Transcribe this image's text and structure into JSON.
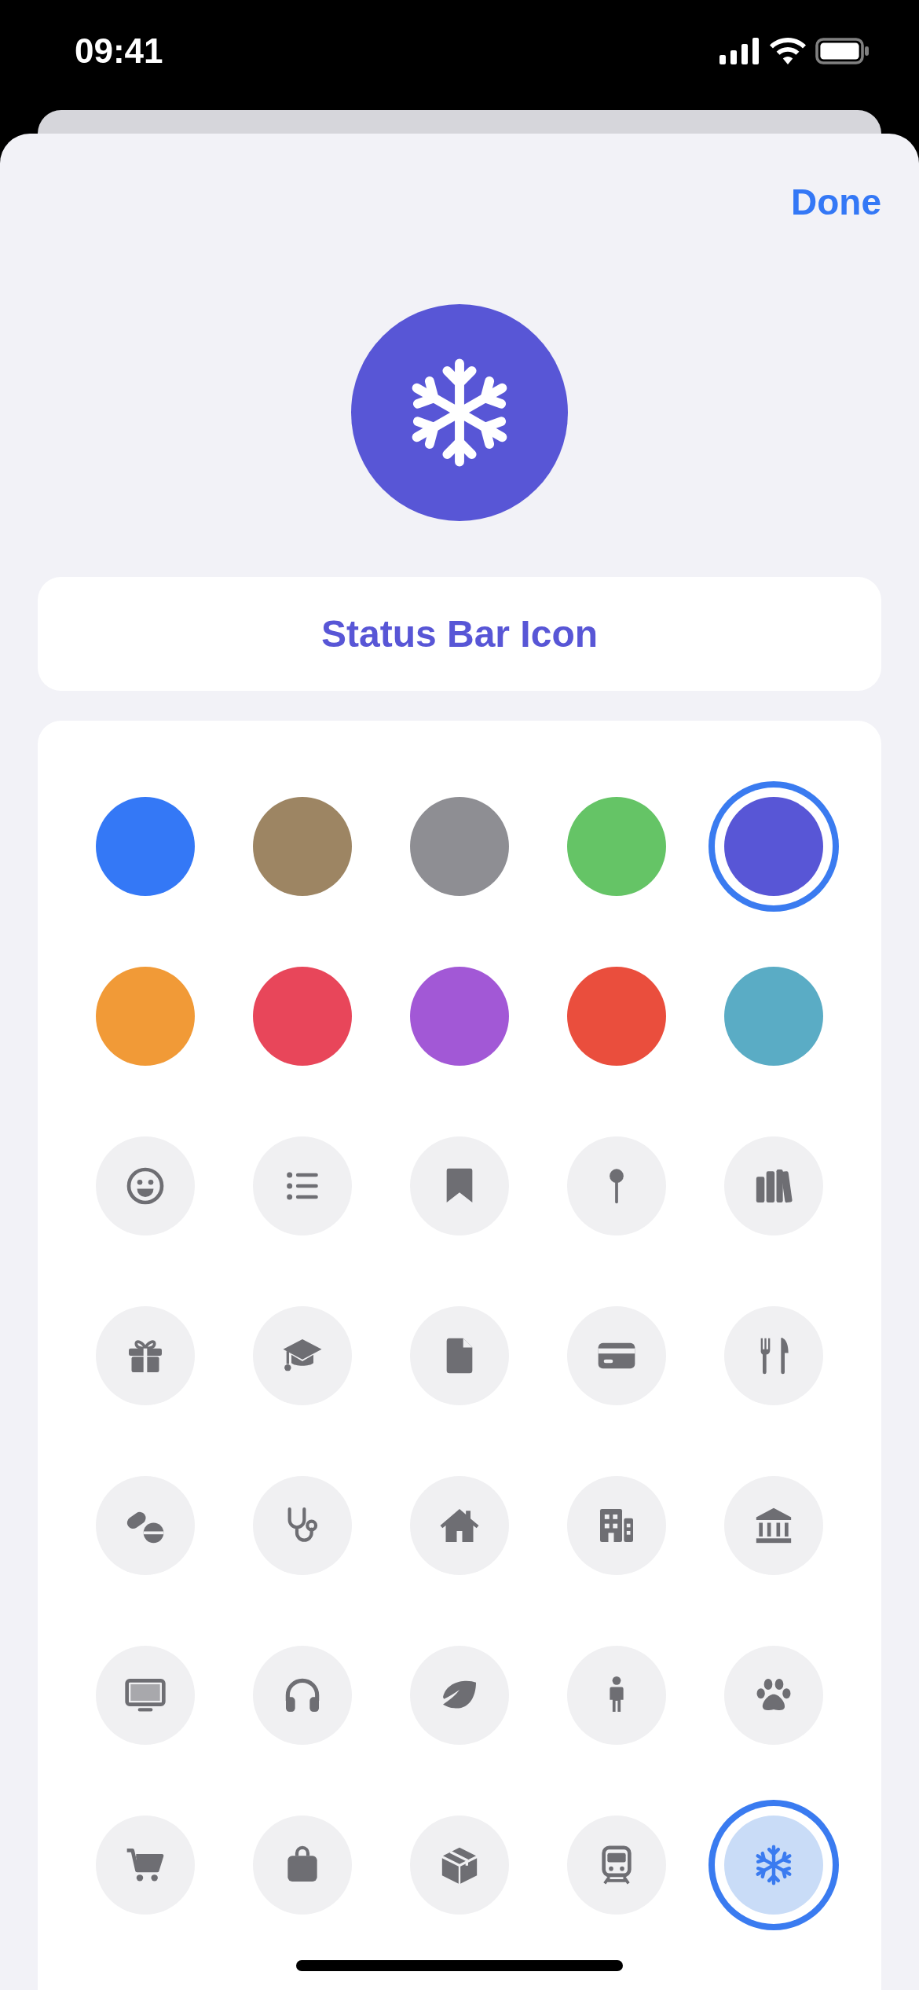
{
  "status_bar": {
    "time": "09:41"
  },
  "header": {
    "done": "Done"
  },
  "name_field": {
    "value": "Status Bar Icon"
  },
  "colors": [
    {
      "color": "#3478f6",
      "selected": false
    },
    {
      "color": "#9d8563",
      "selected": false
    },
    {
      "color": "#8e8e93",
      "selected": false
    },
    {
      "color": "#65c466",
      "selected": false
    },
    {
      "color": "#5856d6",
      "selected": true
    },
    {
      "color": "#f19a37",
      "selected": false
    },
    {
      "color": "#e8465a",
      "selected": false
    },
    {
      "color": "#a258d6",
      "selected": false
    },
    {
      "color": "#ea4e3d",
      "selected": false
    },
    {
      "color": "#5aacc5",
      "selected": false
    }
  ],
  "icons": [
    {
      "kind": "smiley",
      "selected": false
    },
    {
      "kind": "list",
      "selected": false
    },
    {
      "kind": "bookmark",
      "selected": false
    },
    {
      "kind": "pin",
      "selected": false
    },
    {
      "kind": "books",
      "selected": false
    },
    {
      "kind": "gift",
      "selected": false
    },
    {
      "kind": "graduation-cap",
      "selected": false
    },
    {
      "kind": "document",
      "selected": false
    },
    {
      "kind": "credit-card",
      "selected": false
    },
    {
      "kind": "fork-knife",
      "selected": false
    },
    {
      "kind": "pills",
      "selected": false
    },
    {
      "kind": "stethoscope",
      "selected": false
    },
    {
      "kind": "house",
      "selected": false
    },
    {
      "kind": "building",
      "selected": false
    },
    {
      "kind": "bank",
      "selected": false
    },
    {
      "kind": "monitor",
      "selected": false
    },
    {
      "kind": "headphones",
      "selected": false
    },
    {
      "kind": "leaf",
      "selected": false
    },
    {
      "kind": "person",
      "selected": false
    },
    {
      "kind": "paw",
      "selected": false
    },
    {
      "kind": "cart",
      "selected": false
    },
    {
      "kind": "bag",
      "selected": false
    },
    {
      "kind": "box",
      "selected": false
    },
    {
      "kind": "train",
      "selected": false
    },
    {
      "kind": "snowflake",
      "selected": true
    }
  ]
}
